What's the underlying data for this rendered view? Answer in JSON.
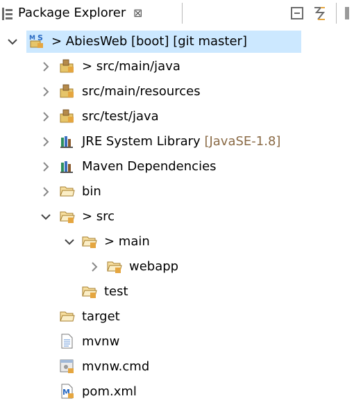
{
  "view": {
    "title": "Package Explorer",
    "close_glyph": "⊠"
  },
  "toolbar": {
    "collapse_all_icon": "collapse-all-icon",
    "link_editor_icon": "link-with-editor-icon"
  },
  "tree": {
    "root": {
      "label": "> AbiesWeb [boot] [git master]",
      "expanded": true
    },
    "items": [
      {
        "label": "> src/main/java",
        "decoration": ""
      },
      {
        "label": "src/main/resources",
        "decoration": ""
      },
      {
        "label": "src/test/java",
        "decoration": ""
      },
      {
        "label": "JRE System Library",
        "decoration": "[JavaSE-1.8]"
      },
      {
        "label": "Maven Dependencies",
        "decoration": ""
      },
      {
        "label": "bin",
        "decoration": ""
      },
      {
        "label": "> src",
        "decoration": ""
      },
      {
        "label": "> main",
        "decoration": ""
      },
      {
        "label": "webapp",
        "decoration": ""
      },
      {
        "label": "test",
        "decoration": ""
      },
      {
        "label": "target",
        "decoration": ""
      },
      {
        "label": "mvnw",
        "decoration": ""
      },
      {
        "label": "mvnw.cmd",
        "decoration": ""
      },
      {
        "label": "pom.xml",
        "decoration": ""
      }
    ]
  }
}
